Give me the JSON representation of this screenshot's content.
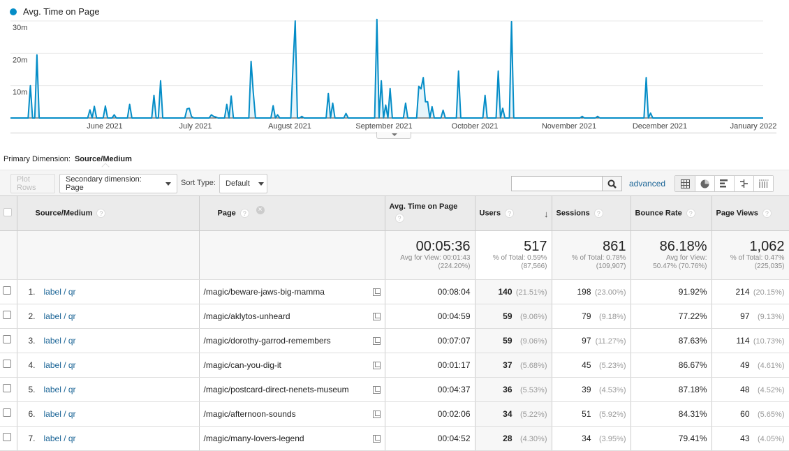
{
  "legend": {
    "label": "Avg. Time on Page",
    "color": "#058dc7"
  },
  "chart_data": {
    "type": "area",
    "title": "",
    "series_name": "Avg. Time on Page",
    "unit": "minutes",
    "y_ticks": [
      "30m",
      "20m",
      "10m"
    ],
    "y_tick_values": [
      30,
      20,
      10
    ],
    "ylim": [
      0,
      30
    ],
    "x_tick_labels": [
      "June 2021",
      "July 2021",
      "August 2021",
      "September 2021",
      "October 2021",
      "November 2021",
      "December 2021",
      "January 2022"
    ],
    "x_tick_day_index": [
      30,
      60,
      91,
      122,
      152,
      183,
      213,
      244
    ],
    "x_start": "2021-05-02",
    "x_end": "2022-01-01",
    "grid": true,
    "legend_position": "top-left",
    "line_color": "#058dc7",
    "fill_color": "#e6f4fa",
    "values": [
      0,
      0,
      0,
      0,
      0,
      0,
      0,
      0,
      0,
      10,
      0,
      0,
      19.5,
      0,
      0,
      0,
      0,
      0,
      0,
      0,
      0,
      0,
      0,
      0,
      0,
      0,
      0,
      0,
      0,
      0,
      0,
      0,
      0,
      0,
      0,
      0,
      2.5,
      0,
      3.6,
      0,
      0,
      0,
      0,
      3.7,
      0,
      0,
      0,
      1,
      0,
      0,
      0,
      0,
      0,
      0,
      4.2,
      0,
      0,
      0,
      0,
      0,
      0,
      0,
      0,
      0,
      0,
      7,
      0,
      0,
      11.5,
      0,
      0,
      0,
      0,
      0,
      0,
      0,
      0,
      0,
      0,
      0,
      2.8,
      3,
      0.5,
      0,
      0,
      0,
      0,
      0,
      0,
      0,
      0,
      1,
      0.5,
      0.3,
      0,
      0,
      0,
      0,
      4.2,
      0,
      6.8,
      0,
      0,
      0,
      0,
      0,
      0,
      0,
      0,
      17.5,
      8,
      0,
      0,
      0,
      0,
      0,
      0,
      0,
      0,
      3.8,
      0,
      1,
      0,
      0,
      0,
      0,
      0,
      0,
      16,
      30,
      0,
      0,
      0.5,
      0,
      0,
      0,
      0,
      0,
      0,
      0,
      0,
      0,
      0,
      0,
      7.6,
      0,
      4.6,
      0,
      0,
      0,
      0,
      0,
      1.4,
      0,
      0,
      0,
      0,
      0,
      0,
      0,
      0,
      0,
      0,
      0,
      0,
      0,
      30.5,
      0,
      11.5,
      0,
      4,
      0,
      9.1,
      0,
      0,
      0,
      0,
      0,
      0,
      4.6,
      0,
      0,
      0,
      0,
      0,
      9.8,
      9,
      12.5,
      5,
      5,
      0,
      3.5,
      0,
      0,
      0,
      0,
      2.4,
      0,
      0,
      0,
      0,
      0,
      0,
      14.5,
      0,
      0,
      0,
      0,
      0,
      0,
      0,
      0,
      0,
      0,
      0,
      7,
      0,
      0,
      0,
      0,
      0,
      14.5,
      0,
      3,
      0,
      0,
      0,
      29.8,
      0,
      0,
      0,
      0,
      0,
      0,
      0,
      0,
      0,
      0,
      0,
      0,
      0,
      0,
      0,
      0,
      0,
      0,
      0,
      0,
      0,
      0,
      0,
      0,
      0,
      0,
      0,
      0,
      0,
      0,
      0,
      0.5,
      0,
      0,
      0,
      0,
      0,
      0,
      0.5,
      0,
      0,
      0,
      0,
      0,
      0,
      0,
      0,
      0,
      0,
      0,
      0,
      0,
      0,
      0,
      0,
      0,
      0,
      0,
      0,
      0,
      12.5,
      0,
      1.5,
      0,
      0,
      0,
      0,
      0,
      0,
      0,
      0,
      0,
      0,
      0,
      0,
      0,
      0,
      0,
      0,
      0,
      0,
      0,
      0,
      0,
      0,
      0,
      0,
      0,
      0,
      0,
      0,
      0,
      0,
      0,
      0,
      0,
      0,
      0,
      0,
      0,
      0,
      0,
      0,
      0,
      0,
      0,
      0,
      0,
      0,
      0,
      0,
      0,
      0,
      0
    ]
  },
  "primary_dimension": {
    "label": "Primary Dimension:",
    "value": "Source/Medium"
  },
  "toolbar": {
    "plot_rows": "Plot Rows",
    "secondary_dimension": "Secondary dimension: Page",
    "sort_type_label": "Sort Type:",
    "sort_type_value": "Default",
    "search_value": "",
    "advanced": "advanced"
  },
  "table": {
    "headers": {
      "source_medium": "Source/Medium",
      "page": "Page",
      "avg_time": "Avg. Time on Page",
      "users": "Users",
      "sessions": "Sessions",
      "bounce_rate": "Bounce Rate",
      "page_views": "Page Views"
    },
    "totals": {
      "avg_time": {
        "value": "00:05:36",
        "line1": "Avg for View: 00:01:43",
        "line2": "(224.20%)"
      },
      "users": {
        "value": "517",
        "line1": "% of Total: 0.59%",
        "line2": "(87,566)"
      },
      "sessions": {
        "value": "861",
        "line1": "% of Total: 0.78%",
        "line2": "(109,907)"
      },
      "bounce_rate": {
        "value": "86.18%",
        "line1": "Avg for View:",
        "line2": "50.47% (70.76%)"
      },
      "page_views": {
        "value": "1,062",
        "line1": "% of Total: 0.47%",
        "line2": "(225,035)"
      }
    },
    "rows": [
      {
        "num": "1.",
        "source": "label / qr",
        "page": "/magic/beware-jaws-big-mamma",
        "avg_time": "00:08:04",
        "users": "140",
        "users_pct": "(21.51%)",
        "sessions": "198",
        "sessions_pct": "(23.00%)",
        "bounce": "91.92%",
        "views": "214",
        "views_pct": "(20.15%)"
      },
      {
        "num": "2.",
        "source": "label / qr",
        "page": "/magic/aklytos-unheard",
        "avg_time": "00:04:59",
        "users": "59",
        "users_pct": "(9.06%)",
        "sessions": "79",
        "sessions_pct": "(9.18%)",
        "bounce": "77.22%",
        "views": "97",
        "views_pct": "(9.13%)"
      },
      {
        "num": "3.",
        "source": "label / qr",
        "page": "/magic/dorothy-garrod-remembers",
        "avg_time": "00:07:07",
        "users": "59",
        "users_pct": "(9.06%)",
        "sessions": "97",
        "sessions_pct": "(11.27%)",
        "bounce": "87.63%",
        "views": "114",
        "views_pct": "(10.73%)"
      },
      {
        "num": "4.",
        "source": "label / qr",
        "page": "/magic/can-you-dig-it",
        "avg_time": "00:01:17",
        "users": "37",
        "users_pct": "(5.68%)",
        "sessions": "45",
        "sessions_pct": "(5.23%)",
        "bounce": "86.67%",
        "views": "49",
        "views_pct": "(4.61%)"
      },
      {
        "num": "5.",
        "source": "label / qr",
        "page": "/magic/postcard-direct-nenets-museum",
        "avg_time": "00:04:37",
        "users": "36",
        "users_pct": "(5.53%)",
        "sessions": "39",
        "sessions_pct": "(4.53%)",
        "bounce": "87.18%",
        "views": "48",
        "views_pct": "(4.52%)"
      },
      {
        "num": "6.",
        "source": "label / qr",
        "page": "/magic/afternoon-sounds",
        "avg_time": "00:02:06",
        "users": "34",
        "users_pct": "(5.22%)",
        "sessions": "51",
        "sessions_pct": "(5.92%)",
        "bounce": "84.31%",
        "views": "60",
        "views_pct": "(5.65%)"
      },
      {
        "num": "7.",
        "source": "label / qr",
        "page": "/magic/many-lovers-legend",
        "avg_time": "00:04:52",
        "users": "28",
        "users_pct": "(4.30%)",
        "sessions": "34",
        "sessions_pct": "(3.95%)",
        "bounce": "79.41%",
        "views": "43",
        "views_pct": "(4.05%)"
      }
    ]
  }
}
